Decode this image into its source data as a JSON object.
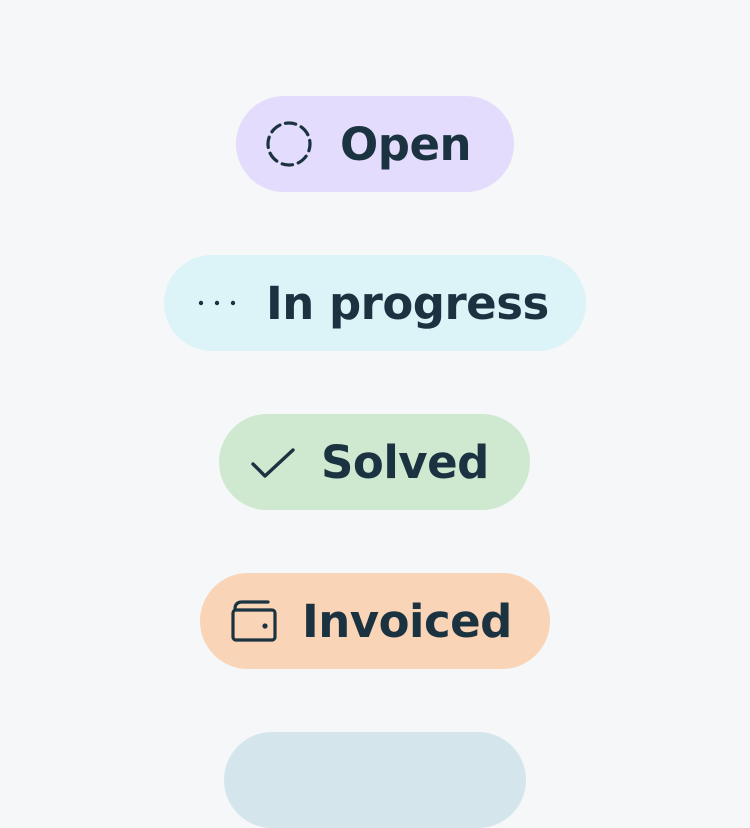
{
  "badges": [
    {
      "label": "Open",
      "icon": "dashed-circle-icon",
      "background": "#e4dcfc"
    },
    {
      "label": "In progress",
      "icon": "ellipsis-icon",
      "background": "#dcf3f8"
    },
    {
      "label": "Solved",
      "icon": "checkmark-icon",
      "background": "#cfe9d1"
    },
    {
      "label": "Invoiced",
      "icon": "wallet-icon",
      "background": "#f9d4b6"
    },
    {
      "label": "",
      "icon": "",
      "background": "#d4e6ec"
    }
  ],
  "colors": {
    "page_background": "#f5f7f9",
    "text": "#1b3340"
  }
}
